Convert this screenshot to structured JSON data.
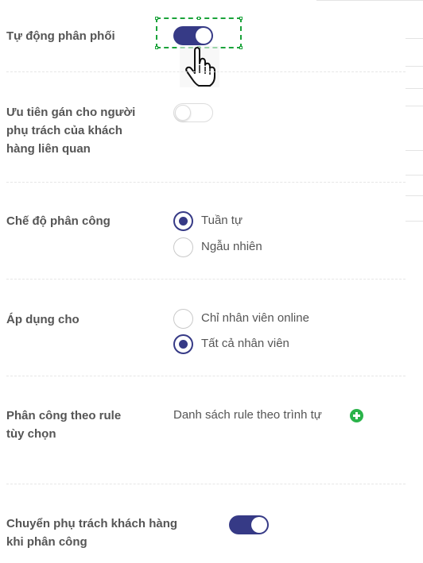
{
  "settings": {
    "auto_assign": {
      "label": "Tự động phân phối",
      "enabled": true
    },
    "priority_owner": {
      "label_line1": "Ưu tiên gán cho người",
      "label_line2": "phụ trách của khách",
      "label_line3": "hàng liên quan",
      "enabled": false
    },
    "assign_mode": {
      "label": "Chế độ phân công",
      "options": [
        {
          "label": "Tuần tự",
          "checked": true
        },
        {
          "label": "Ngẫu nhiên",
          "checked": false
        }
      ]
    },
    "apply_to": {
      "label": "Áp dụng cho",
      "options": [
        {
          "label": "Chỉ nhân viên online",
          "checked": false
        },
        {
          "label": "Tất cả nhân viên",
          "checked": true
        }
      ]
    },
    "custom_rule": {
      "label_line1": "Phân công theo rule",
      "label_line2": "tùy chọn",
      "list_label": "Danh sách rule theo trình tự",
      "add_icon": "plus-circle-icon"
    },
    "transfer_owner": {
      "label_line1": "Chuyển phụ trách khách hàng",
      "label_line2": "khi phân công",
      "enabled": true
    }
  },
  "colors": {
    "accent": "#363a86",
    "add_green": "#2ab34a",
    "selection_green": "#1aa33a"
  },
  "cursor_icon": "hand-pointer-icon"
}
